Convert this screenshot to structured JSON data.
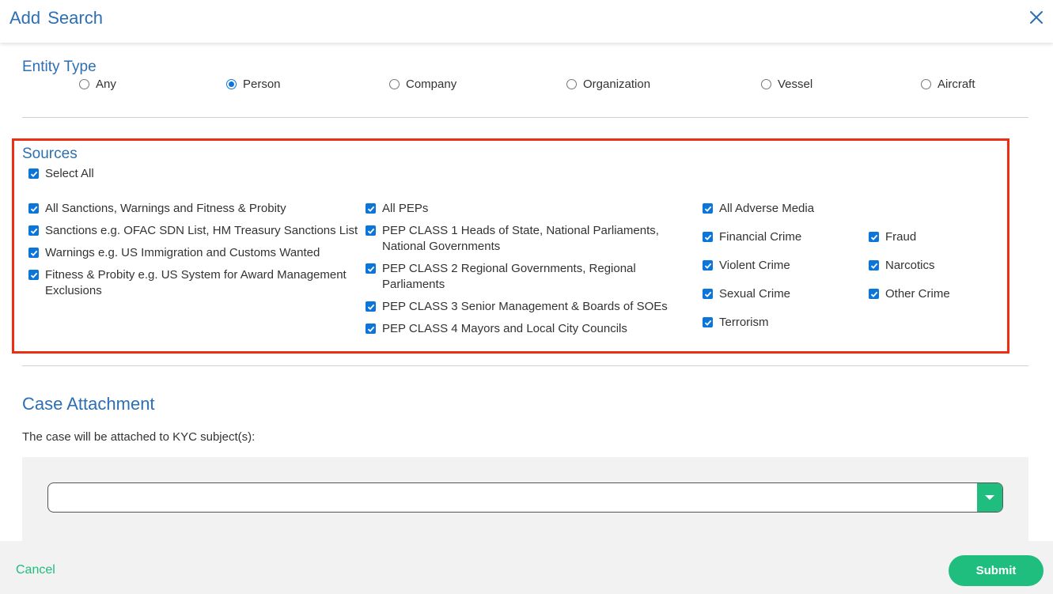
{
  "header": {
    "title": "Add Search"
  },
  "entity_type": {
    "title": "Entity Type",
    "options": [
      {
        "label": "Any",
        "selected": false
      },
      {
        "label": "Person",
        "selected": true
      },
      {
        "label": "Company",
        "selected": false
      },
      {
        "label": "Organization",
        "selected": false
      },
      {
        "label": "Vessel",
        "selected": false
      },
      {
        "label": "Aircraft",
        "selected": false
      }
    ]
  },
  "sources": {
    "title": "Sources",
    "select_all": "Select All",
    "sanctions": {
      "all": "All Sanctions, Warnings and Fitness & Probity",
      "items": [
        [
          "Sanctions e.g. OFAC SDN List, HM Treasury Sanctions List"
        ],
        [
          "Warnings e.g. US Immigration and Customs Wanted"
        ],
        [
          "Fitness & Probity e.g. US System for Award Management",
          "Exclusions"
        ]
      ]
    },
    "peps": {
      "all": "All PEPs",
      "items": [
        [
          "PEP CLASS 1 Heads of State, National Parliaments,",
          "National Governments"
        ],
        [
          "PEP CLASS 2 Regional Governments, Regional",
          "Parliaments"
        ],
        [
          "PEP CLASS 3 Senior Management & Boards of SOEs"
        ],
        [
          "PEP CLASS 4 Mayors and Local City Councils"
        ]
      ]
    },
    "adverse_media": {
      "all": "All Adverse Media",
      "items": [
        "Financial Crime",
        "Fraud",
        "Violent Crime",
        "Narcotics",
        "Sexual Crime",
        "Other Crime",
        "Terrorism"
      ]
    },
    "checked": true
  },
  "case_attachment": {
    "title": "Case Attachment",
    "note": "The case will be attached to KYC subject(s):",
    "select_value": ""
  },
  "footer": {
    "cancel_label": "Cancel",
    "submit_label": "Submit"
  },
  "colors": {
    "title_blue": "#2d6fb2",
    "checkbox_blue": "#0b75d9",
    "accent_green": "#1fbd7e",
    "highlight_red": "#ef2d12"
  }
}
